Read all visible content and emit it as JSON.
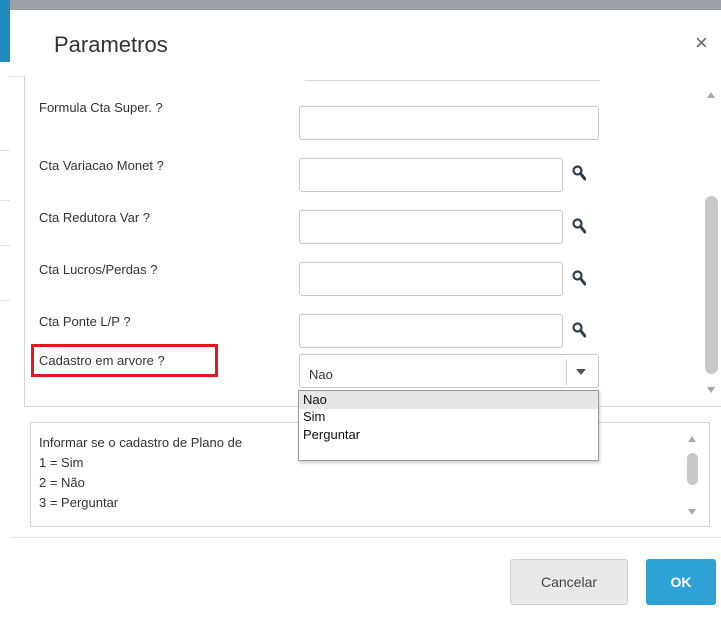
{
  "dialog": {
    "title": "Parametros",
    "close_symbol": "×"
  },
  "fields": [
    {
      "label": "Formula Cta Super. ?",
      "value": "",
      "has_lookup": false
    },
    {
      "label": "Cta Variacao Monet ?",
      "value": "",
      "has_lookup": true
    },
    {
      "label": "Cta Redutora Var ?",
      "value": "",
      "has_lookup": true
    },
    {
      "label": "Cta Lucros/Perdas ?",
      "value": "",
      "has_lookup": true
    },
    {
      "label": "Cta Ponte L/P ?",
      "value": "",
      "has_lookup": true
    }
  ],
  "tree_field": {
    "label": "Cadastro em arvore ?",
    "selected": "Nao",
    "options": [
      "Nao",
      "Sim",
      "Perguntar"
    ]
  },
  "help": {
    "lines": [
      "Informar se o cadastro de Plano de",
      "1 = Sim",
      "2 = Não",
      "3 = Perguntar"
    ]
  },
  "buttons": {
    "cancel": "Cancelar",
    "ok": "OK"
  },
  "colors": {
    "accent": "#2ea1d6",
    "highlight": "#e8141f"
  },
  "icons": {
    "lookup": "magnifier-icon",
    "close": "close-icon",
    "dropdown": "chevron-down-icon"
  }
}
